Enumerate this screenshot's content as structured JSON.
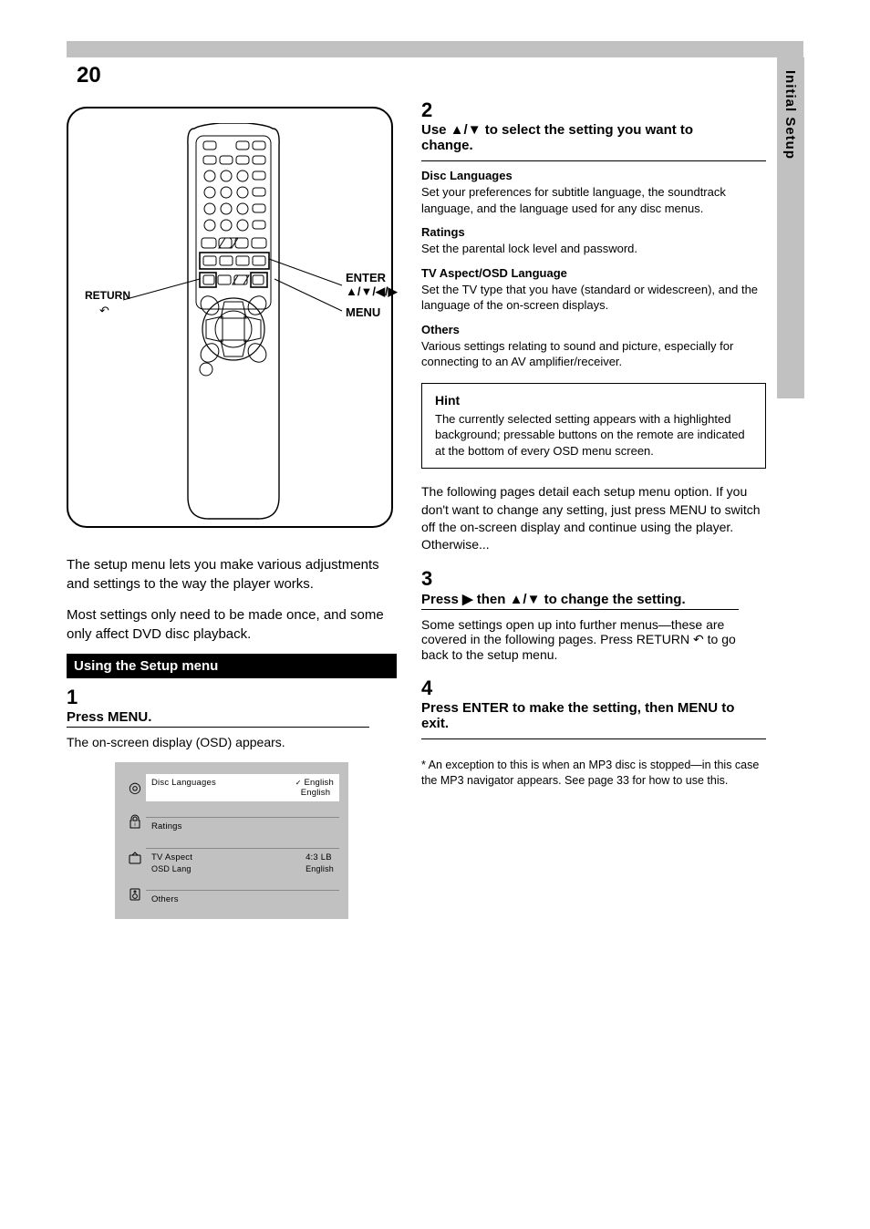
{
  "page_number": "20",
  "side_tab": "Initial Setup",
  "remote_labels": {
    "enter": "ENTER\n▲/▼/◀/▶",
    "return": "RETURN",
    "menu": "MENU"
  },
  "intro_paragraphs": {
    "p1": "The setup menu lets you make various adjustments and settings to the way the player works.",
    "p2": "Most settings only need to be made once, and some only affect DVD disc playback."
  },
  "setup_heading": "Using the Setup menu",
  "step1": {
    "num": "1",
    "line1": "Press MENU.",
    "line2": "The on-screen display (OSD) appears."
  },
  "osd": {
    "row1": {
      "label": "Disc Languages",
      "valueA": "English",
      "valueB": "English"
    },
    "row2": {
      "label": "Ratings",
      "valueA": "",
      "valueB": ""
    },
    "row3": {
      "label": "TV Aspect",
      "sub": "OSD Lang",
      "valueA": "4:3 LB",
      "valueB": "English"
    },
    "row4": {
      "label": "Others",
      "valueA": "",
      "valueB": ""
    }
  },
  "step2": {
    "num": "2",
    "line": "Use ▲/▼ to select the setting you want to change."
  },
  "settings": {
    "disc_languages": {
      "title": "Disc Languages",
      "body": "Set your preferences for subtitle language, the soundtrack language, and the language used for any disc menus."
    },
    "ratings": {
      "title": "Ratings",
      "body": "Set the parental lock level and password."
    },
    "tv_aspect": {
      "title": "TV Aspect/OSD Language",
      "body": "Set the TV type that you have (standard or widescreen), and the language of the on-screen displays."
    },
    "others": {
      "title": "Others",
      "body": "Various settings relating to sound and picture, especially for connecting to an AV amplifier/receiver."
    }
  },
  "hint": {
    "title": "Hint",
    "body": "The currently selected setting appears with a highlighted background; pressable buttons on the remote are indicated at the bottom of every OSD menu screen."
  },
  "step3_intro": "The following pages detail each setup menu option. If you don't want to change any setting, just press MENU to switch off the on-screen display and continue using the player. Otherwise...",
  "step3": {
    "num": "3",
    "line1": "Press ▶ then ▲/▼ to change the setting.",
    "line2_prefix": "Some settings open up into further menus—these are covered in the following pages. Press RETURN ",
    "line2_suffix": " to go back to the setup menu."
  },
  "step4": {
    "num": "4",
    "line": "Press ENTER to make the setting, then MENU to exit."
  },
  "footnote": "* An exception to this is when an MP3 disc is stopped—in this case the MP3 navigator appears. See page 33 for how to use this."
}
